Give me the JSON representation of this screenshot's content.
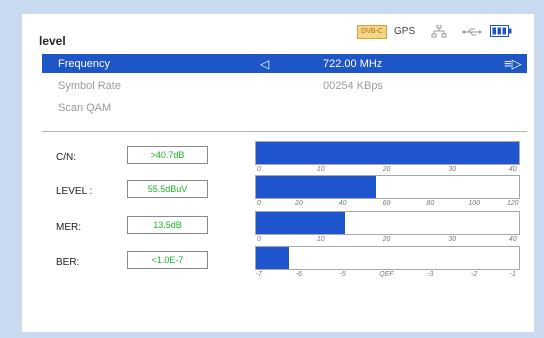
{
  "header": {
    "title": "level",
    "dvb_badge": "DVB-C",
    "gps_label": "GPS"
  },
  "menu": [
    {
      "label": "Frequency",
      "value": "722.00 MHz",
      "selected": true
    },
    {
      "label": "Symbol Rate",
      "value": "00254 KBps",
      "selected": false
    },
    {
      "label": "Scan QAM",
      "value": "",
      "selected": false
    }
  ],
  "nav": {
    "left_arrow": "◁",
    "right_arrow": "≡▷"
  },
  "meters": [
    {
      "label": "C/N:",
      "value": ">40.7dB",
      "level": 1.0,
      "scale": [
        "0",
        "10",
        "20",
        "30",
        "40"
      ]
    },
    {
      "label": "LEVEL :",
      "value": "55.5dBuV",
      "level": 0.458,
      "scale": [
        "0",
        "20",
        "40",
        "60",
        "80",
        "100",
        "120"
      ]
    },
    {
      "label": "MER:",
      "value": "13.5dB",
      "level": 0.3375,
      "scale": [
        "0",
        "10",
        "20",
        "30",
        "40"
      ]
    },
    {
      "label": "BER:",
      "value": "<1.0E-7",
      "level": 0.125,
      "scale": [
        "-7",
        "-6",
        "-5",
        "QEF",
        "-3",
        "-2",
        "-1"
      ]
    }
  ],
  "colors": {
    "accent": "#1e56c7",
    "value_text": "#1fb42a",
    "page_bg": "#c9d9ef"
  },
  "icons": [
    "dvb-badge",
    "network-icon",
    "usb-icon",
    "battery-icon"
  ]
}
